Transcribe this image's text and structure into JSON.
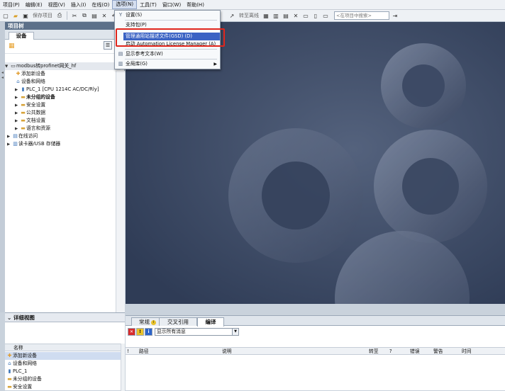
{
  "menubar": [
    "项目(P)",
    "编辑(E)",
    "视图(V)",
    "插入(I)",
    "在线(O)",
    "选项(N)",
    "工具(T)",
    "窗口(W)",
    "帮助(H)"
  ],
  "toolbar": {
    "save_label": "保存项目",
    "go_offline_label": "转至离线",
    "search_placeholder": "<在项目中搜索>"
  },
  "project_tree": {
    "title": "项目树",
    "tab_label": "设备",
    "items": [
      {
        "label": "modbus转profinet网关_hf",
        "icon": "project-icon"
      },
      {
        "label": "添加新设备",
        "icon": "add-device-icon"
      },
      {
        "label": "设备和网络",
        "icon": "network-icon"
      },
      {
        "label": "PLC_1 [CPU 1214C AC/DC/Rly]",
        "icon": "plc-icon"
      },
      {
        "label": "未分组的设备",
        "icon": "folder-icon"
      },
      {
        "label": "安全设置",
        "icon": "folder-icon"
      },
      {
        "label": "公共数据",
        "icon": "folder-icon"
      },
      {
        "label": "文档设置",
        "icon": "folder-icon"
      },
      {
        "label": "语言和资源",
        "icon": "folder-icon"
      },
      {
        "label": "在线访问",
        "icon": "online-icon"
      },
      {
        "label": "读卡器/USB 存储器",
        "icon": "card-reader-icon"
      }
    ]
  },
  "details_view": {
    "title": "详细视图",
    "column_name": "名称",
    "items": [
      "添加新设备",
      "设备和网络",
      "PLC_1",
      "未分组的设备",
      "安全设置"
    ]
  },
  "options_menu": {
    "items": [
      {
        "label": "设置(S)",
        "enabled": true
      },
      {
        "label": "支持包(P)",
        "enabled": true
      },
      {
        "label": "管理通用站描述文件(GSD) (D)",
        "enabled": true,
        "highlighted": true
      },
      {
        "label": "启动 Automation License Manager (A)",
        "enabled": true
      },
      {
        "label": "显示参考文本(W)",
        "enabled": true
      },
      {
        "label": "全局库(G)",
        "enabled": true
      }
    ]
  },
  "inspector": {
    "tabs": [
      "常规",
      "交叉引用",
      "编译"
    ],
    "active_tab": "编译",
    "filter_value": "显示所有消息",
    "columns": [
      "路径",
      "说明",
      "转至",
      "?",
      "错误",
      "警告",
      "时间"
    ]
  },
  "colors": {
    "menu_highlight": "#3b63c4",
    "annotation_red": "#e1261c",
    "workspace_bg": "#3b4a66",
    "panel_title": "#5c7089"
  }
}
